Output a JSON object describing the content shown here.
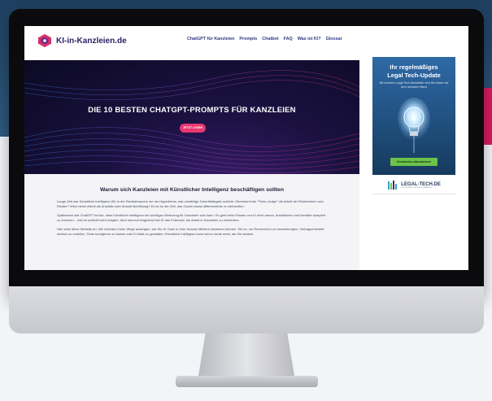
{
  "site": {
    "logo_text": "KI-in-Kanzleien.de"
  },
  "nav": {
    "items": [
      {
        "label": "ChatGPT für Kanzleien"
      },
      {
        "label": "Prompts"
      },
      {
        "label": "Chatbot"
      },
      {
        "label": "FAQ"
      },
      {
        "label": "Was ist KI?"
      },
      {
        "label": "Glossar"
      }
    ]
  },
  "hero": {
    "title": "DIE 10 BESTEN CHATGPT-PROMPTS FÜR KANZLEIEN",
    "button_label": "JETZT LESEN"
  },
  "article": {
    "title": "Warum sich Kanzleien mit Künstlicher Intelligenz beschäftigen sollten",
    "paragraphs": [
      "Lange Zeit war Künstliche Intelligenz (KI) in der Rechtsbranche nur ein Hypethema, das unmäßige Zukunftsängste schürte: Übernimmt der \"Robo-Judge\" die Arbeit der Richterinnen und Richter? Wird meine Arbeit als Anwältin oder Anwalt überflüssig? Es ist an der Zeit, das Ganze etwas differenzierter zu betrachten.",
      "Spätestens seit ChatGPT ist klar, dass Künstliche Intelligenz ein wichtiges Werkzeug für Kanzleien sein kann. Es geht beim Einsatz von KI nicht darum, Anwältinnen und Anwälte komplett zu ersetzen – das ist schlicht nicht möglich. Aber sinnvoll eingesetzt hat KI das Potenzial, die Arbeit in Kanzleien zu erleichtern.",
      "Hier setzt diese Website an: Wir möchten Ihnen Wege aufzeigen, wie Sie KI-Tools in Ihrer Kanzlei effizient einsetzen können. Sei es, um Recherchen zu beschleunigen, Vertragsentwürfe einfach zu erstellen, Texte korrigieren zu lassen oder E-Mails zu gestalten: Künstliche Intelligenz kann schon heute mehr, als Sie denken."
    ]
  },
  "ad": {
    "title_line1": "Ihr regelmäßiges",
    "title_line2": "Legal Tech-Update",
    "subtitle": "Mit unserem Legal Tech-Newsletter sind Sie immer auf dem neuesten Stand",
    "button_label": "Kostenlos abonnieren",
    "brand_name": "LEGAL-TECH.DE",
    "brand_tagline": "DIE ZUKUNFT DES RECHTSMARKTS"
  },
  "colors": {
    "accent_pink": "#e8386f",
    "nav_text": "#2e3a7c",
    "ad_button": "#6cc24a",
    "background_top": "#1f3f60"
  }
}
